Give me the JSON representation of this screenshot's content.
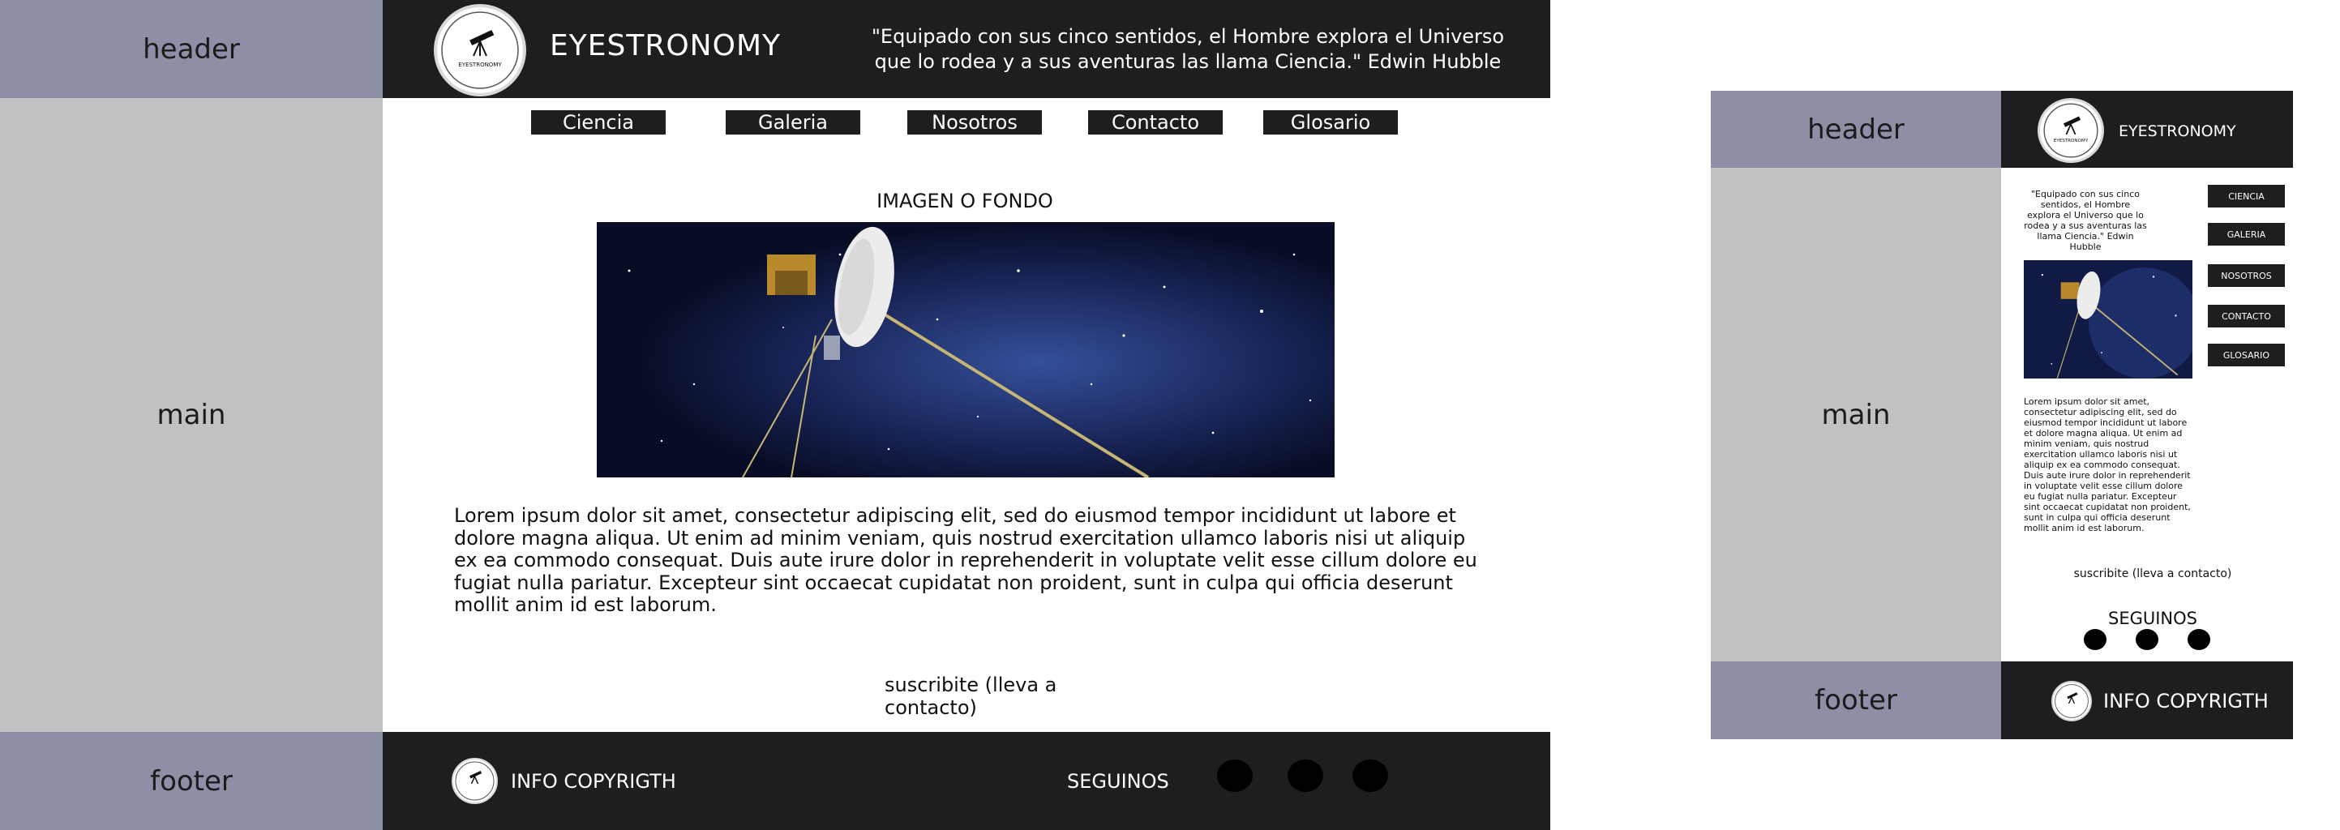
{
  "labels": {
    "header": "header",
    "main": "main",
    "footer": "footer"
  },
  "desktop": {
    "brand": "EYESTRONOMY",
    "logo_text": "EYESTRONOMY",
    "quote": "\"Equipado con sus cinco sentidos, el Hombre explora el Universo que lo rodea y a sus aventuras las llama Ciencia.\" Edwin Hubble",
    "nav": [
      "Ciencia",
      "Galeria",
      "Nosotros",
      "Contacto",
      "Glosario"
    ],
    "image_label": "IMAGEN O FONDO",
    "body": "Lorem ipsum dolor sit amet, consectetur adipiscing elit, sed do eiusmod tempor incididunt ut labore et dolore magna aliqua. Ut enim ad minim veniam, quis nostrud exercitation ullamco laboris nisi ut aliquip ex ea commodo consequat. Duis aute irure dolor in reprehenderit in voluptate velit esse cillum dolore eu fugiat nulla pariatur. Excepteur sint occaecat cupidatat non proident, sunt in culpa qui officia deserunt mollit anim id est laborum.",
    "subscribe": "suscribite (lleva a contacto)",
    "footer_copy": "INFO COPYRIGTH",
    "follow": "SEGUINOS"
  },
  "mobile": {
    "brand": "EYESTRONOMY",
    "logo_text": "EYESTRONOMY",
    "quote": "\"Equipado con sus cinco sentidos, el Hombre explora el Universo que lo rodea y a sus aventuras las llama Ciencia.\" Edwin Hubble",
    "nav": [
      "CIENCIA",
      "GALERIA",
      "NOSOTROS",
      "CONTACTO",
      "GLOSARIO"
    ],
    "body": "Lorem ipsum dolor sit amet, consectetur adipiscing elit, sed do eiusmod tempor incididunt ut labore et dolore magna aliqua. Ut enim ad minim veniam, quis nostrud exercitation ullamco laboris nisi ut aliquip ex ea commodo consequat. Duis aute irure dolor in reprehenderit in voluptate velit esse cillum dolore eu fugiat nulla pariatur. Excepteur sint occaecat cupidatat non proident, sunt in culpa qui officia deserunt mollit anim id est laborum.",
    "subscribe": "suscribite (lleva a contacto)",
    "follow": "SEGUINOS",
    "footer_copy": "INFO COPYRIGTH"
  },
  "colors": {
    "dark": "#1e1e20",
    "label_blue": "#8c8fa6",
    "label_gray": "#c1c1c1",
    "space": "#0a1030"
  },
  "icons": [
    "telescope-icon",
    "social-icon"
  ]
}
